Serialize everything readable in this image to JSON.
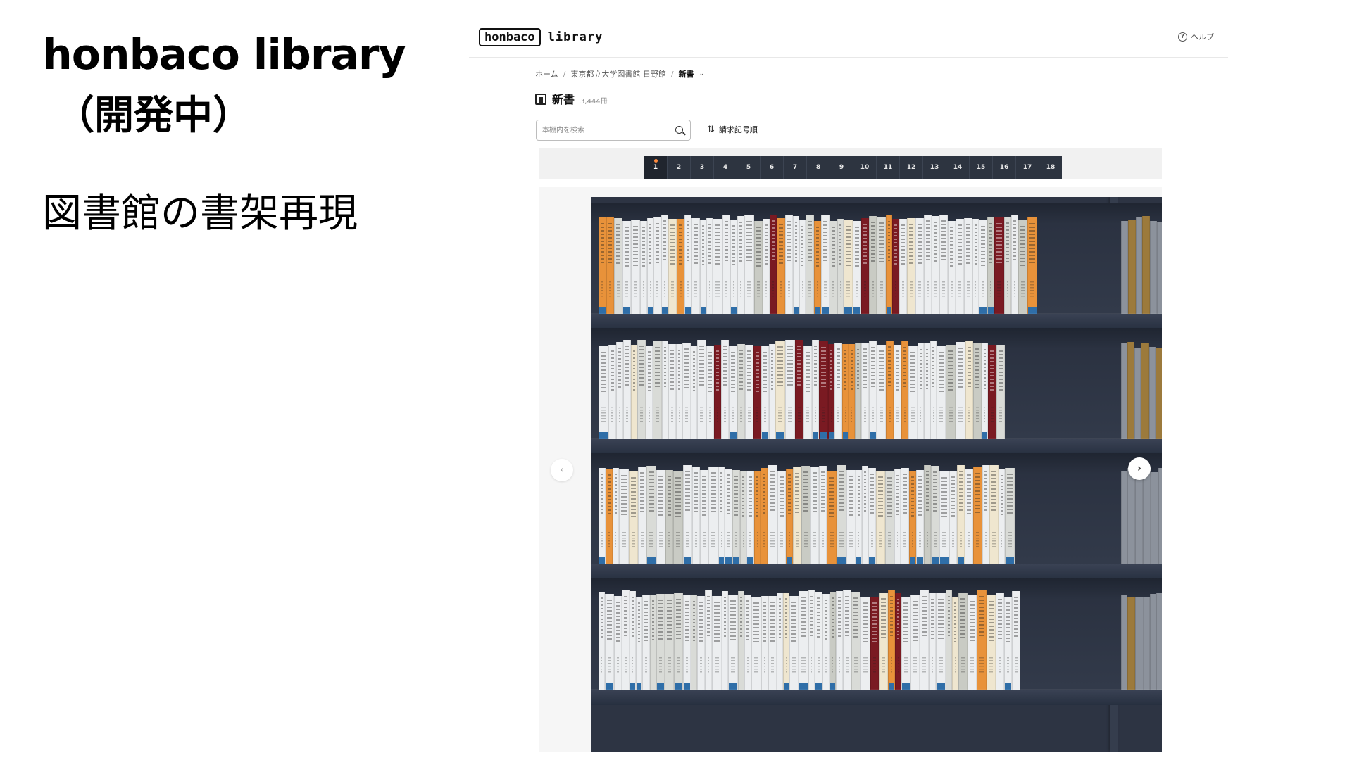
{
  "slide": {
    "title": "honbaco library",
    "subtitle": "（開発中）",
    "caption": "図書館の書架再現"
  },
  "header": {
    "logo_box": "honbaco",
    "logo_word": "library",
    "help_icon": "help-circle-icon",
    "help_label": "ヘルプ"
  },
  "breadcrumb": {
    "home": "ホーム",
    "library": "東京都立大学図書館 日野館",
    "current": "新書"
  },
  "collection": {
    "name": "新書",
    "count": "3,444冊"
  },
  "search": {
    "placeholder": "本棚内を検索",
    "value": ""
  },
  "sort": {
    "label": "請求記号順",
    "icon": "sort-arrows-icon"
  },
  "pager": {
    "pages": [
      "1",
      "2",
      "3",
      "4",
      "5",
      "6",
      "7",
      "8",
      "9",
      "10",
      "11",
      "12",
      "13",
      "14",
      "15",
      "16",
      "17",
      "18"
    ],
    "active": "1"
  },
  "colors": {
    "bookcase": "#2d3443",
    "pager_bg": "#2d3440",
    "active_dot": "#ff8a3d",
    "spine_white": "#eceef0",
    "spine_red": "#7a1a22",
    "spine_orange": "#e8923a",
    "spine_cream": "#efe6cf",
    "band_blue": "#2f6ea8"
  }
}
